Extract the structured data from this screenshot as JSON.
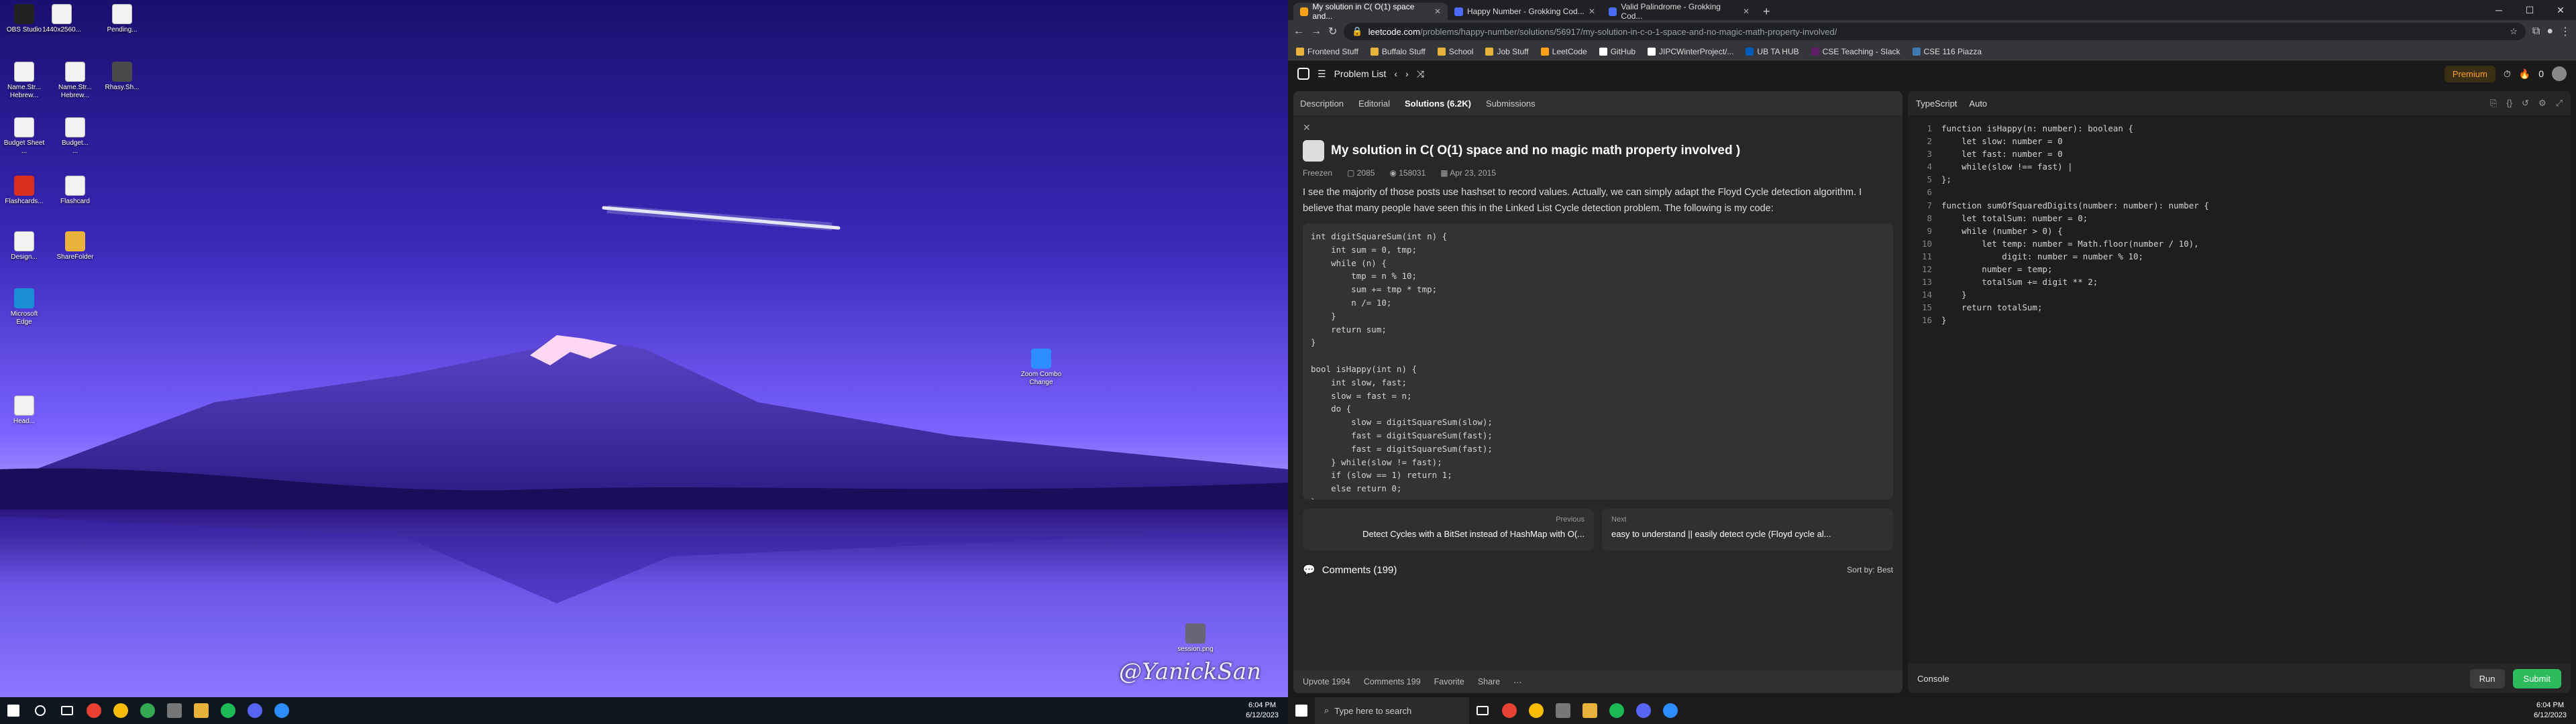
{
  "desktop": {
    "icons": [
      {
        "label": "OBS Studio",
        "kind": "app",
        "color": "#222"
      },
      {
        "label": "1440x2560...",
        "kind": "doc",
        "color": ""
      },
      {
        "label": "Pending...",
        "kind": "doc",
        "color": ""
      },
      {
        "label": "Name.Str...\nHebrew...",
        "kind": "doc",
        "color": ""
      },
      {
        "label": "Name.Str...\nHebrew...",
        "kind": "doc",
        "color": ""
      },
      {
        "label": "Rhasy.Sh...",
        "kind": "app",
        "color": "#4a4a4a"
      },
      {
        "label": "Budget Sheet\n...",
        "kind": "doc",
        "color": ""
      },
      {
        "label": "Budget...\n...",
        "kind": "doc",
        "color": ""
      },
      {
        "label": "Flashcards...",
        "kind": "app",
        "color": "#d9301e"
      },
      {
        "label": "Flashcard",
        "kind": "doc",
        "color": ""
      },
      {
        "label": "Design...",
        "kind": "doc",
        "color": ""
      },
      {
        "label": "ShareFolder",
        "kind": "folder",
        "color": ""
      },
      {
        "label": "Microsoft\nEdge",
        "kind": "app",
        "color": "#1b8fd6"
      },
      {
        "label": "Head...",
        "kind": "doc",
        "color": ""
      },
      {
        "label": "Zoom Combo\nChange",
        "kind": "app",
        "color": "#2d8cff"
      },
      {
        "label": "session.png",
        "kind": "app",
        "color": "#667"
      }
    ],
    "watermark": "@YanickSan",
    "clock": {
      "time": "6:04 PM",
      "date": "6/12/2023"
    }
  },
  "browser": {
    "tabs": [
      {
        "title": "My solution in C( O(1) space and...",
        "color": "#ffa116"
      },
      {
        "title": "Happy Number - Grokking Cod...",
        "color": "#4a6cf7"
      },
      {
        "title": "Valid Palindrome - Grokking Cod...",
        "color": "#4a6cf7"
      }
    ],
    "url_host": "leetcode.com",
    "url_path": "/problems/happy-number/solutions/56917/my-solution-in-c-o-1-space-and-no-magic-math-property-involved/",
    "bookmarks": [
      {
        "label": "Frontend Stuff",
        "color": "#e8b33a"
      },
      {
        "label": "Buffalo Stuff",
        "color": "#e8b33a"
      },
      {
        "label": "School",
        "color": "#e8b33a"
      },
      {
        "label": "Job Stuff",
        "color": "#e8b33a"
      },
      {
        "label": "LeetCode",
        "color": "#ffa116"
      },
      {
        "label": "GitHub",
        "color": "#ffffff"
      },
      {
        "label": "JIPCWinterProject/...",
        "color": "#ffffff"
      },
      {
        "label": "UB TA HUB",
        "color": "#005bbb"
      },
      {
        "label": "CSE Teaching - Slack",
        "color": "#611f69"
      },
      {
        "label": "CSE 116 Piazza",
        "color": "#3e7aab"
      }
    ]
  },
  "leetcode": {
    "problem_list": "Problem List",
    "premium": "Premium",
    "streak": "0",
    "tabs": [
      "Description",
      "Editorial",
      "Solutions (6.2K)",
      "Submissions"
    ],
    "solution": {
      "title": "My solution in C( O(1) space and no magic math property involved )",
      "author": "Freezen",
      "votes": "2085",
      "views": "158031",
      "date": "Apr 23, 2015",
      "desc": "I see the majority of those posts use hashset to record values. Actually, we can simply adapt the Floyd Cycle detection algorithm. I believe that many people have seen this in the Linked List Cycle detection problem. The following is my code:",
      "code": "int digitSquareSum(int n) {\n    int sum = 0, tmp;\n    while (n) {\n        tmp = n % 10;\n        sum += tmp * tmp;\n        n /= 10;\n    }\n    return sum;\n}\n\nbool isHappy(int n) {\n    int slow, fast;\n    slow = fast = n;\n    do {\n        slow = digitSquareSum(slow);\n        fast = digitSquareSum(fast);\n        fast = digitSquareSum(fast);\n    } while(slow != fast);\n    if (slow == 1) return 1;\n    else return 0;\n}"
    },
    "prev": {
      "label": "Previous",
      "title": "Detect Cycles with a BitSet instead of HashMap with O(..."
    },
    "next": {
      "label": "Next",
      "title": "easy to understand || easily detect cycle (Floyd cycle al..."
    },
    "comments": "Comments (199)",
    "sort": "Sort by: Best",
    "actions": {
      "upvote": "Upvote 1994",
      "comments": "Comments 199",
      "favorite": "Favorite",
      "share": "Share"
    },
    "editor": {
      "language": "TypeScript",
      "mode": "Auto",
      "lines": [
        "1",
        "2",
        "3",
        "4",
        "5",
        "6",
        "7",
        "8",
        "9",
        "10",
        "11",
        "12",
        "13",
        "14",
        "15",
        "16"
      ],
      "code": "function isHappy(n: number): boolean {\n    let slow: number = 0\n    let fast: number = 0\n    while(slow !== fast) |\n};\n\nfunction sumOfSquaredDigits(number: number): number {\n    let totalSum: number = 0;\n    while (number > 0) {\n        let temp: number = Math.floor(number / 10),\n            digit: number = number % 10;\n        number = temp;\n        totalSum += digit ** 2;\n    }\n    return totalSum;\n}"
    },
    "console": "Console",
    "run": "Run",
    "submit": "Submit"
  },
  "taskbar": {
    "search": "Type here to search",
    "time": "6:04 PM",
    "date": "6/12/2023"
  }
}
